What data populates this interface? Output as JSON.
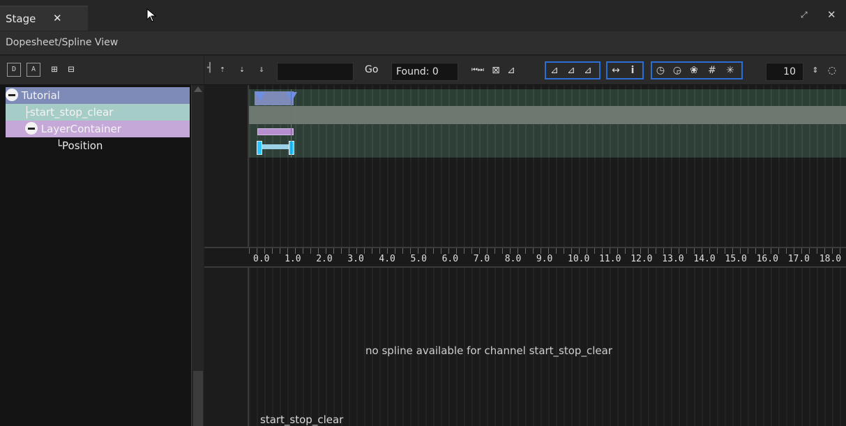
{
  "tabs": [
    {
      "label": "Stage"
    }
  ],
  "title": "Dopesheet/Spline View",
  "tree": {
    "items": [
      {
        "label": "Tutorial"
      },
      {
        "label": "start_stop_clear"
      },
      {
        "label": "LayerContainer"
      },
      {
        "label": "Position"
      }
    ]
  },
  "toolbar": {
    "go_label": "Go",
    "found_label": "Found: 0",
    "value": "10",
    "icons": [
      "tree-dopesheet-icon",
      "tree-add-icon",
      "key-insert-icon",
      "key-delete-icon",
      "scroll-up-icon",
      "scroll-down-icon",
      "filter-icon",
      "goto-start-end-icon",
      "graph-icon",
      "line-icon",
      "spline-mode-1-icon",
      "spline-mode-2-icon",
      "spline-mode-3-icon",
      "move-icon",
      "info-icon",
      "clock-icon",
      "clock-alt-icon",
      "group-icon",
      "grid-icon",
      "snap-icon",
      "spinner-icon",
      "refresh-icon"
    ]
  },
  "ruler": {
    "labels": [
      "0.0",
      "1.0",
      "2.0",
      "3.0",
      "4.0",
      "5.0",
      "6.0",
      "7.0",
      "8.0",
      "9.0",
      "10.0",
      "11.0",
      "12.0",
      "13.0",
      "14.0",
      "15.0",
      "16.0",
      "17.0",
      "18.0"
    ]
  },
  "spline": {
    "message": "no spline available for channel start_stop_clear",
    "channel": "start_stop_clear"
  },
  "colors": {
    "tutorial": "#7e8ab8",
    "start_stop_clear": "#a6ccc8",
    "layer_container": "#c5a8d8",
    "playhead": "#e0433a",
    "key": "#2ec4ff",
    "accent": "#2b6fd6"
  }
}
